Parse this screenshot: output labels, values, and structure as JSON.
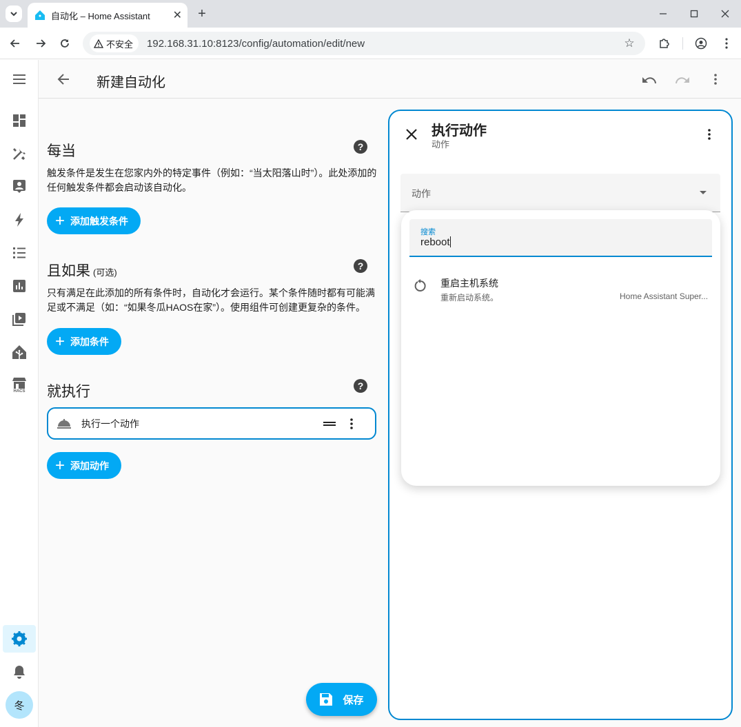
{
  "browser": {
    "tab_title": "自动化 – Home Assistant",
    "security_label": "不安全",
    "url": "192.168.31.10:8123/config/automation/edit/new"
  },
  "header": {
    "title": "新建自动化"
  },
  "sidebar": {
    "items": [
      {
        "name": "overview",
        "icon": "dashboard-icon"
      },
      {
        "name": "settings-tools",
        "icon": "tools-icon"
      },
      {
        "name": "profile",
        "icon": "account-box-icon"
      },
      {
        "name": "energy",
        "icon": "lightning-icon"
      },
      {
        "name": "logbook",
        "icon": "list-icon"
      },
      {
        "name": "history",
        "icon": "chart-box-icon"
      },
      {
        "name": "media",
        "icon": "play-box-icon"
      },
      {
        "name": "home",
        "icon": "home-assistant-icon"
      },
      {
        "name": "hacs",
        "icon": "hacs-icon",
        "label": "HACS"
      }
    ],
    "settings_icon": "gear-icon",
    "notifications_icon": "bell-icon",
    "user_initial": "冬",
    "accent": "#03a9f4"
  },
  "triggers": {
    "title": "每当",
    "description": "触发条件是发生在您家内外的特定事件（例如：“当太阳落山时”）。此处添加的任何触发条件都会启动该自动化。",
    "add_label": "添加触发条件"
  },
  "conditions": {
    "title": "且如果",
    "optional": "(可选)",
    "description": "只有满足在此添加的所有条件时，自动化才会运行。某个条件随时都有可能满足或不满足（如：“如果冬瓜HAOS在家”）。使用组件可创建更复杂的条件。",
    "add_label": "添加条件"
  },
  "actions": {
    "title": "就执行",
    "item_label": "执行一个动作",
    "add_label": "添加动作"
  },
  "save_label": "保存",
  "pane": {
    "title": "执行动作",
    "subtitle": "动作",
    "select_label": "动作",
    "search_label": "搜索",
    "search_value": "reboot",
    "result": {
      "title": "重启主机系统",
      "subtitle": "重新启动系统。",
      "source": "Home Assistant Super..."
    }
  },
  "colors": {
    "primary": "#03a9f4",
    "border": "#0288d1"
  }
}
